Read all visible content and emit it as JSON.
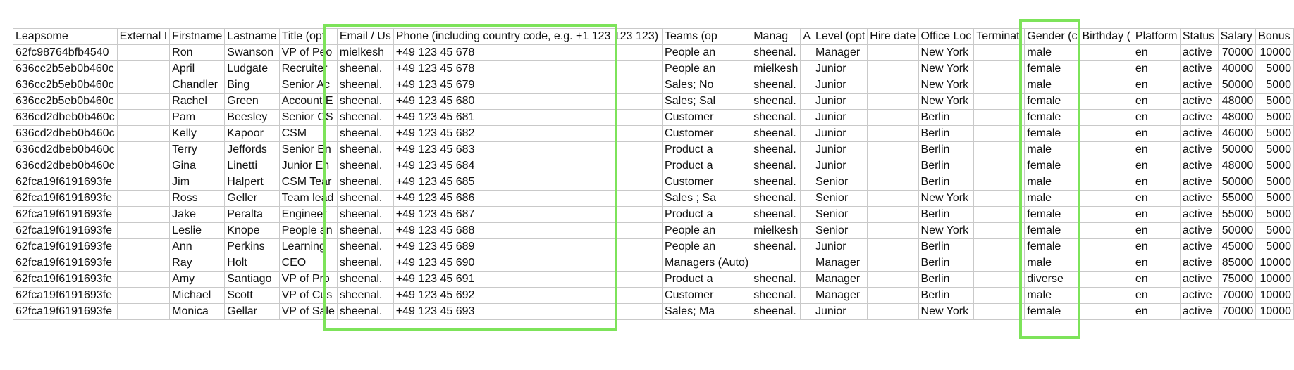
{
  "highlight_color": "#7de35a",
  "sheet": {
    "headers": [
      "Leapsome",
      "External I",
      "Firstname",
      "Lastname",
      "Title (opt",
      "Email / Us",
      "Phone (including country code, e.g. +1 123 123 123)",
      "Teams (op",
      "Manag",
      "A",
      "Level (opt",
      "Hire date",
      "Office Loc",
      "Terminati",
      "Gender (c",
      "Birthday (",
      "Platform",
      "Status",
      "Salary",
      "Bonus"
    ],
    "rows": [
      [
        "62fc98764bfb4540",
        "",
        "Ron",
        "Swanson",
        "VP of Peo",
        "mielkesh",
        "+49 123 45 678",
        "People an",
        "sheenal.",
        "",
        "Manager",
        "",
        "New York",
        "",
        "male",
        "",
        "en",
        "active",
        "70000",
        "10000"
      ],
      [
        "636cc2b5eb0b460c",
        "",
        "April",
        "Ludgate",
        "Recruiter",
        "sheenal.",
        "+49 123 45 678",
        "People an",
        "mielkesh",
        "",
        "Junior",
        "",
        "New York",
        "",
        "female",
        "",
        "en",
        "active",
        "40000",
        "5000"
      ],
      [
        "636cc2b5eb0b460c",
        "",
        "Chandler",
        "Bing",
        "Senior Ac",
        "sheenal.",
        "+49 123 45 679",
        "Sales; No",
        "sheenal.",
        "",
        "Junior",
        "",
        "New York",
        "",
        "male",
        "",
        "en",
        "active",
        "50000",
        "5000"
      ],
      [
        "636cc2b5eb0b460c",
        "",
        "Rachel",
        "Green",
        "Account E",
        "sheenal.",
        "+49 123 45 680",
        "Sales; Sal",
        "sheenal.",
        "",
        "Junior",
        "",
        "New York",
        "",
        "female",
        "",
        "en",
        "active",
        "48000",
        "5000"
      ],
      [
        "636cd2dbeb0b460c",
        "",
        "Pam",
        "Beesley",
        "Senior CS",
        "sheenal.",
        "+49 123 45 681",
        "Customer",
        "sheenal.",
        "",
        "Junior",
        "",
        "Berlin",
        "",
        "female",
        "",
        "en",
        "active",
        "48000",
        "5000"
      ],
      [
        "636cd2dbeb0b460c",
        "",
        "Kelly",
        "Kapoor",
        "CSM",
        "sheenal.",
        "+49 123 45 682",
        "Customer",
        "sheenal.",
        "",
        "Junior",
        "",
        "Berlin",
        "",
        "female",
        "",
        "en",
        "active",
        "46000",
        "5000"
      ],
      [
        "636cd2dbeb0b460c",
        "",
        "Terry",
        "Jeffords",
        "Senior En",
        "sheenal.",
        "+49 123 45 683",
        "Product a",
        "sheenal.",
        "",
        "Junior",
        "",
        "Berlin",
        "",
        "male",
        "",
        "en",
        "active",
        "50000",
        "5000"
      ],
      [
        "636cd2dbeb0b460c",
        "",
        "Gina",
        "Linetti",
        "Junior En",
        "sheenal.",
        "+49 123 45 684",
        "Product a",
        "sheenal.",
        "",
        "Junior",
        "",
        "Berlin",
        "",
        "female",
        "",
        "en",
        "active",
        "48000",
        "5000"
      ],
      [
        "62fca19f6191693fe",
        "",
        "Jim",
        "Halpert",
        "CSM Tear",
        "sheenal.",
        "+49 123 45 685",
        "Customer",
        "sheenal.",
        "",
        "Senior",
        "",
        "Berlin",
        "",
        "male",
        "",
        "en",
        "active",
        "50000",
        "5000"
      ],
      [
        "62fca19f6191693fe",
        "",
        "Ross",
        "Geller",
        "Team lead",
        "sheenal.",
        "+49 123 45 686",
        "Sales ; Sa",
        "sheenal.",
        "",
        "Senior",
        "",
        "New York",
        "",
        "male",
        "",
        "en",
        "active",
        "55000",
        "5000"
      ],
      [
        "62fca19f6191693fe",
        "",
        "Jake",
        "Peralta",
        "Engineer",
        "sheenal.",
        "+49 123 45 687",
        "Product a",
        "sheenal.",
        "",
        "Senior",
        "",
        "Berlin",
        "",
        "female",
        "",
        "en",
        "active",
        "55000",
        "5000"
      ],
      [
        "62fca19f6191693fe",
        "",
        "Leslie",
        "Knope",
        "People an",
        "sheenal.",
        "+49 123 45 688",
        "People an",
        "mielkesh",
        "",
        "Senior",
        "",
        "New York",
        "",
        "female",
        "",
        "en",
        "active",
        "50000",
        "5000"
      ],
      [
        "62fca19f6191693fe",
        "",
        "Ann",
        "Perkins",
        "Learning",
        "sheenal.",
        "+49 123 45 689",
        "People an",
        "sheenal.",
        "",
        "Junior",
        "",
        "Berlin",
        "",
        "female",
        "",
        "en",
        "active",
        "45000",
        "5000"
      ],
      [
        "62fca19f6191693fe",
        "",
        "Ray",
        "Holt",
        "CEO",
        "sheenal.",
        "+49 123 45 690",
        "Managers (Auto)",
        "",
        "",
        "Manager",
        "",
        "Berlin",
        "",
        "male",
        "",
        "en",
        "active",
        "85000",
        "10000"
      ],
      [
        "62fca19f6191693fe",
        "",
        "Amy",
        "Santiago",
        "VP of Pro",
        "sheenal.",
        "+49 123 45 691",
        "Product a",
        "sheenal.",
        "",
        "Manager",
        "",
        "Berlin",
        "",
        "diverse",
        "",
        "en",
        "active",
        "75000",
        "10000"
      ],
      [
        "62fca19f6191693fe",
        "",
        "Michael",
        "Scott",
        "VP of Cus",
        "sheenal.",
        "+49 123 45 692",
        "Customer",
        "sheenal.",
        "",
        "Manager",
        "",
        "Berlin",
        "",
        "male",
        "",
        "en",
        "active",
        "70000",
        "10000"
      ],
      [
        "62fca19f6191693fe",
        "",
        "Monica",
        "Gellar",
        "VP of Sale",
        "sheenal.",
        "+49 123 45 693",
        "Sales; Ma",
        "sheenal.",
        "",
        "Junior",
        "",
        "New York",
        "",
        "female",
        "",
        "en",
        "active",
        "70000",
        "10000"
      ]
    ]
  }
}
